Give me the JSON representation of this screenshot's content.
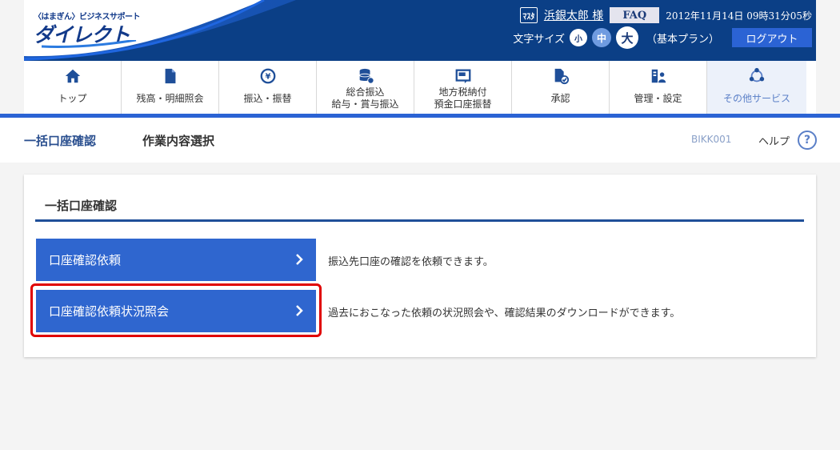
{
  "header": {
    "logo_small": "〈はまぎん〉ビジネスサポート",
    "logo_main": "ダイレクト",
    "user_icon_label": "ﾏｽﾀ",
    "user_name": "浜銀太郎 様",
    "faq_label": "FAQ",
    "datetime": "2012年11月14日 09時31分05秒",
    "font_size_label": "文字サイズ",
    "font_small": "小",
    "font_medium": "中",
    "font_large": "大",
    "plan": "（基本プラン）",
    "logout_label": "ログアウト"
  },
  "nav": {
    "items": [
      {
        "label": "トップ",
        "icon": "home-icon"
      },
      {
        "label": "残高・明細照会",
        "icon": "document-icon"
      },
      {
        "label": "振込・振替",
        "icon": "yen-transfer-icon"
      },
      {
        "label": "総合振込",
        "label2": "給与・賞与振込",
        "icon": "database-icon"
      },
      {
        "label": "地方税納付",
        "label2": "預金口座振替",
        "icon": "tax-icon"
      },
      {
        "label": "承認",
        "icon": "approval-icon"
      },
      {
        "label": "管理・設定",
        "icon": "admin-icon"
      },
      {
        "label": "その他サービス",
        "icon": "other-services-icon"
      }
    ]
  },
  "titlebar": {
    "title": "一括口座確認",
    "subtitle": "作業内容選択",
    "screen_code": "BIKK001",
    "help_label": "ヘルプ",
    "help_icon": "?"
  },
  "card": {
    "title": "一括口座確認",
    "actions": [
      {
        "label": "口座確認依頼",
        "description": "振込先口座の確認を依頼できます。"
      },
      {
        "label": "口座確認依頼状況照会",
        "description": "過去におこなった依頼の状況照会や、確認結果のダウンロードができます。"
      }
    ]
  },
  "colors": {
    "brand_blue": "#0b3f86",
    "accent_blue": "#2f66cf",
    "highlight_red": "#e00000"
  }
}
